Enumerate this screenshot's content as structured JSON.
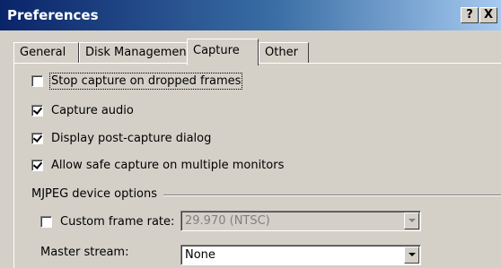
{
  "window": {
    "title": "Preferences",
    "help_label": "?",
    "close_label": "X"
  },
  "tabs": [
    {
      "label": "General"
    },
    {
      "label": "Disk Management"
    },
    {
      "label": "Capture",
      "active": true
    },
    {
      "label": "Other"
    }
  ],
  "options": {
    "stop_capture": {
      "label": "Stop capture on dropped frames",
      "checked": false
    },
    "capture_audio": {
      "label": "Capture audio",
      "checked": true
    },
    "post_capture": {
      "label": "Display post-capture dialog",
      "checked": true
    },
    "safe_capture": {
      "label": "Allow safe capture on multiple monitors",
      "checked": true
    }
  },
  "mjpeg": {
    "group_label": "MJPEG device options",
    "custom_frame_rate": {
      "label": "Custom frame rate:",
      "checked": false
    },
    "frame_rate_value": "29.970 (NTSC)",
    "master_stream_label": "Master stream:",
    "master_stream_value": "None"
  }
}
